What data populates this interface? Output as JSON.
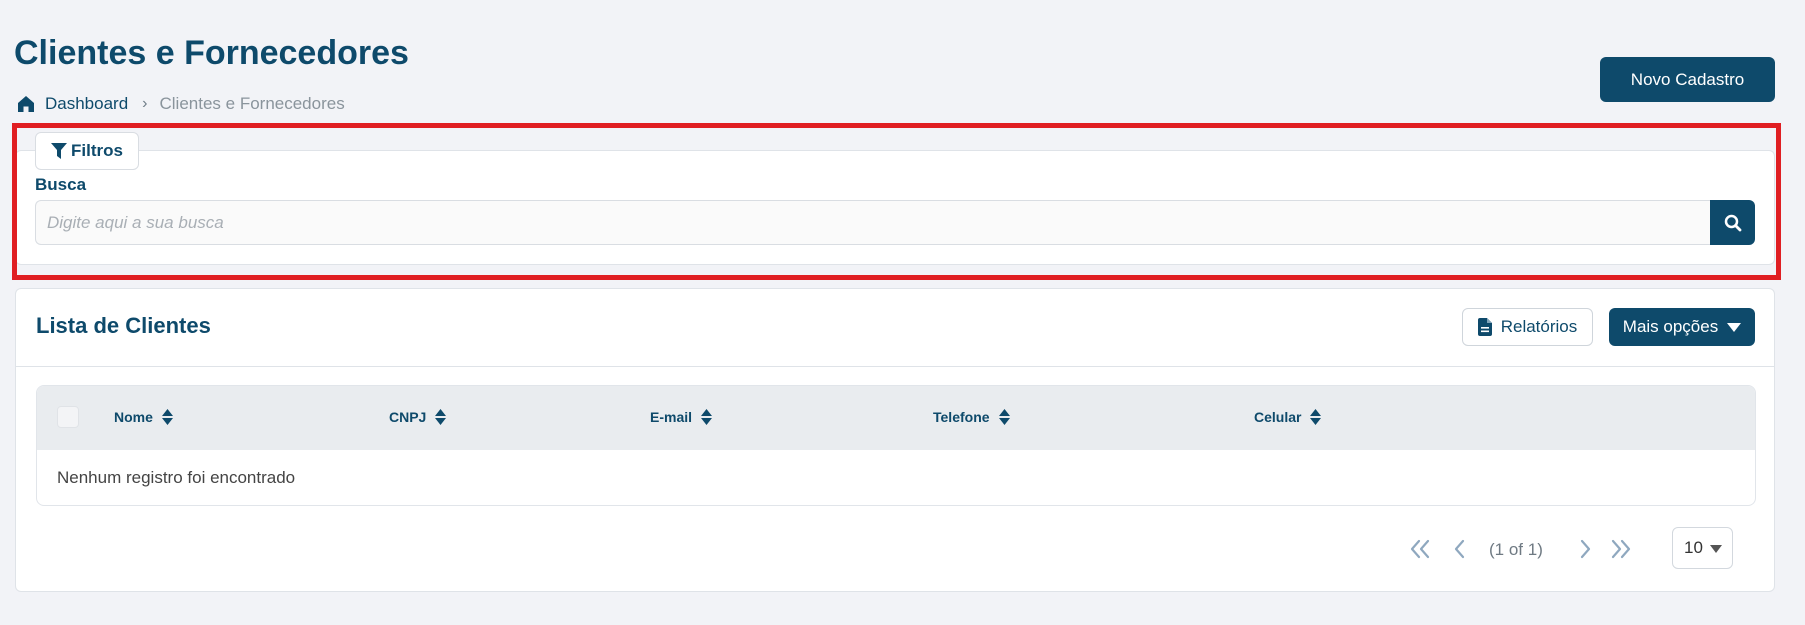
{
  "header": {
    "title": "Clientes e Fornecedores",
    "new_button": "Novo Cadastro"
  },
  "breadcrumb": {
    "home_icon": "home-icon",
    "link": "Dashboard",
    "separator_icon": "chevron-right-icon",
    "current": "Clientes e Fornecedores"
  },
  "filters": {
    "tab_label": "Filtros",
    "tab_icon": "filter-icon",
    "search_label": "Busca",
    "search_placeholder": "Digite aqui a sua busca",
    "search_value": "",
    "search_button_icon": "search-icon"
  },
  "list": {
    "title": "Lista de Clientes",
    "reports_button": "Relatórios",
    "reports_icon": "file-icon",
    "more_options_button": "Mais opções",
    "more_options_icon": "caret-down-icon",
    "columns": [
      "Nome",
      "CNPJ",
      "E-mail",
      "Telefone",
      "Celular"
    ],
    "sort_icon": "sort-icon",
    "empty_message": "Nenhum registro foi encontrado"
  },
  "pagination": {
    "info": "(1 of 1)",
    "page_size": "10",
    "first_icon": "double-chevron-left-icon",
    "prev_icon": "chevron-left-icon",
    "next_icon": "chevron-right-icon",
    "last_icon": "double-chevron-right-icon"
  },
  "colors": {
    "primary": "#0e4a6b",
    "highlight": "#e01e22",
    "background": "#f2f3f7"
  }
}
